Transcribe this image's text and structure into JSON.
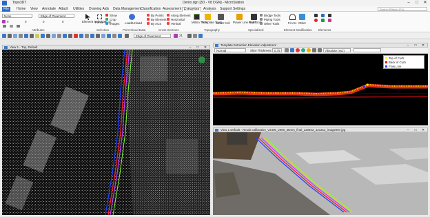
{
  "titlebar": {
    "app": "Topo3DT",
    "document": "Demo.dgn [3D - V8 DGN] - MicroStation",
    "minimize": "–",
    "maximize": "□",
    "close": "✕"
  },
  "tabs": [
    "File",
    "Home",
    "View",
    "Annotate",
    "Attach",
    "Utilities",
    "Drawing Aids",
    "Data Management",
    "Classification",
    "Assessment",
    "Extraction",
    "Analysis",
    "Support",
    "Settings"
  ],
  "active_tab": "Extraction",
  "search_placeholder": "Search Ribbon (F4)",
  "ribbon": {
    "level_select": "None",
    "edge_select": "Edge of Pavement",
    "attributes_row_values": [
      "0",
      "0",
      "0",
      "0"
    ],
    "groups": {
      "attributes": "Attributes",
      "selection": "Selection",
      "point_cloud": "Point Cloud Data",
      "cross_sections": "Cross Sections",
      "topography": "Topography",
      "specialized": "Specialized",
      "element_modification": "Element Modification",
      "elements": "Elements"
    },
    "element_selection": "Element Selection",
    "fence_tools": "Fence Tools",
    "show": "Show",
    "crop": "Crop",
    "images": "Images",
    "load_unload": "Load/Unload",
    "by_points": "By Points",
    "by_element": "By Element",
    "by_acs": "By ACS",
    "along_element": "Along Element",
    "horizontal": "Horizontal",
    "vertical": "Vertical",
    "milestone_tools": "Milton Tools",
    "template_tools": "Template Tools",
    "smart_cell": "Smart Cell",
    "power_line_tools": "Power Line Tools",
    "rail_tools": "Rail Tools",
    "bridge_tools": "Bridge Tools",
    "piping_tools": "Piping Tools",
    "other_tools": "Other Tools",
    "fit_arc": "Fit Arc",
    "other": "Other"
  },
  "toolbar2": {
    "edge_value": "Edge of Pavement",
    "scale_value": "21"
  },
  "view1": {
    "title": "View 1 - Top, Default"
  },
  "view2": {
    "title": "Template Extraction Elevation Adjustment",
    "mode": "Normal",
    "thickness_label": "Slice Thickness:",
    "thickness_value": "0.75",
    "absolute_label": "Absolute (xyz)",
    "legend": [
      {
        "label": "Top of Curb",
        "color": "#ffff00"
      },
      {
        "label": "Back of Curb",
        "color": "#ff0000"
      },
      {
        "label": "Flow Line",
        "color": "#1a3cff"
      }
    ]
  },
  "view3": {
    "title": "View 1 Default - Result calibration_V2400_2000_35mm_final_120402_121312_image007.jpg"
  },
  "colors": {
    "accent": "#2a6cc4",
    "lime_line": "#7cff2a",
    "red_line": "#ff2020",
    "blue_line": "#2040ff",
    "purple_line": "#c040ff"
  }
}
